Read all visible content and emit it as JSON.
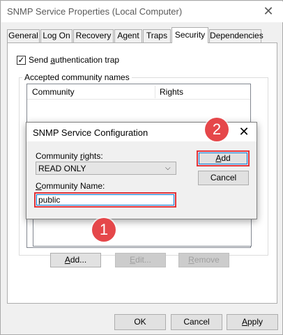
{
  "window": {
    "title": "SNMP Service Properties (Local Computer)",
    "close_glyph": "✕"
  },
  "tabs": [
    "General",
    "Log On",
    "Recovery",
    "Agent",
    "Traps",
    "Security",
    "Dependencies"
  ],
  "active_tab": "Security",
  "security": {
    "send_auth_trap": {
      "pre": "Send ",
      "ul": "a",
      "post": "uthentication trap",
      "checked": true
    },
    "accepted_group_label": "Accepted community names",
    "list_headers": {
      "community": "Community",
      "rights": "Rights"
    },
    "buttons": {
      "add": {
        "pre": "",
        "ul": "A",
        "post": "dd..."
      },
      "edit": {
        "pre": "",
        "ul": "E",
        "post": "dit..."
      },
      "remove": {
        "pre": "",
        "ul": "R",
        "post": "emove"
      }
    }
  },
  "footer": {
    "ok": "OK",
    "cancel": "Cancel",
    "apply": {
      "pre": "",
      "ul": "A",
      "post": "pply"
    }
  },
  "dialog": {
    "title": "SNMP Service Configuration",
    "close_glyph": "✕",
    "rights_label": {
      "pre": "Community ",
      "ul": "r",
      "post": "ights:"
    },
    "rights_value": "READ ONLY",
    "name_label": {
      "pre": "",
      "ul": "C",
      "post": "ommunity Name:"
    },
    "name_value": "public",
    "add": {
      "pre": "",
      "ul": "A",
      "post": "dd"
    },
    "cancel": "Cancel"
  },
  "annotations": {
    "badge1": "1",
    "badge2": "2",
    "color": "#e5474a"
  }
}
